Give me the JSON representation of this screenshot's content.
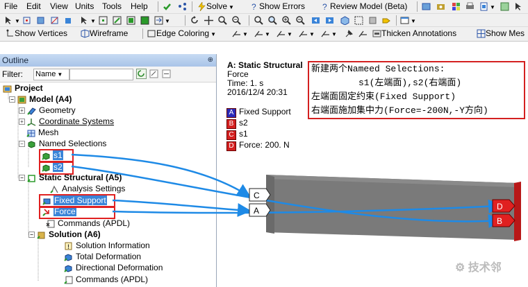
{
  "menu": [
    "File",
    "Edit",
    "View",
    "Units",
    "Tools",
    "Help"
  ],
  "toolbar1": {
    "solve": "Solve",
    "show_errors": "Show Errors",
    "review_model": "Review Model (Beta)"
  },
  "toolbar2": {
    "show_vertices": "Show Vertices",
    "wireframe": "Wireframe",
    "edge_coloring": "Edge Coloring",
    "thicken_annotations": "Thicken Annotations",
    "show_mesh": "Show Mes"
  },
  "outline": {
    "title": "Outline",
    "filter_label": "Filter:",
    "filter_value": "Name",
    "tree": {
      "project": "Project",
      "model": "Model (A4)",
      "geometry": "Geometry",
      "coordinate_systems": "Coordinate Systems",
      "mesh": "Mesh",
      "named_selections": "Named Selections",
      "s1": "s1",
      "s2": "s2",
      "static_structural": "Static Structural (A5)",
      "analysis_settings": "Analysis Settings",
      "fixed_support": "Fixed Support",
      "force": "Force",
      "commands_a5": "Commands (APDL)",
      "solution": "Solution (A6)",
      "solution_information": "Solution Information",
      "total_deformation": "Total Deformation",
      "directional_deformation": "Directional Deformation",
      "commands_a6": "Commands (APDL)"
    }
  },
  "viewport": {
    "title": "A: Static Structural",
    "subtitle": "Force",
    "time": "Time: 1. s",
    "date": "2016/12/4 20:31",
    "legend": [
      {
        "tag": "A",
        "label": "Fixed Support",
        "color": "#2a2ab8"
      },
      {
        "tag": "B",
        "label": "s2",
        "color": "#d42020"
      },
      {
        "tag": "C",
        "label": "s1",
        "color": "#d42020"
      },
      {
        "tag": "D",
        "label": "Force: 200. N",
        "color": "#d42020"
      }
    ],
    "model_tags": {
      "c": "C",
      "a": "A",
      "d": "D",
      "b": "B"
    }
  },
  "annotation": {
    "line1": "新建两个Nameed Selections:",
    "line2": "s1(左端面),s2(右端面)",
    "line3": "左端面固定约束(Fixed Support)",
    "line4": "右端面施加集中力(Force=-200N,-Y方向)"
  },
  "watermark": "技术邻",
  "colors": {
    "accent": "#3a84d8",
    "annotation_red": "#e02020",
    "arrow_blue": "#1e8ae6"
  }
}
